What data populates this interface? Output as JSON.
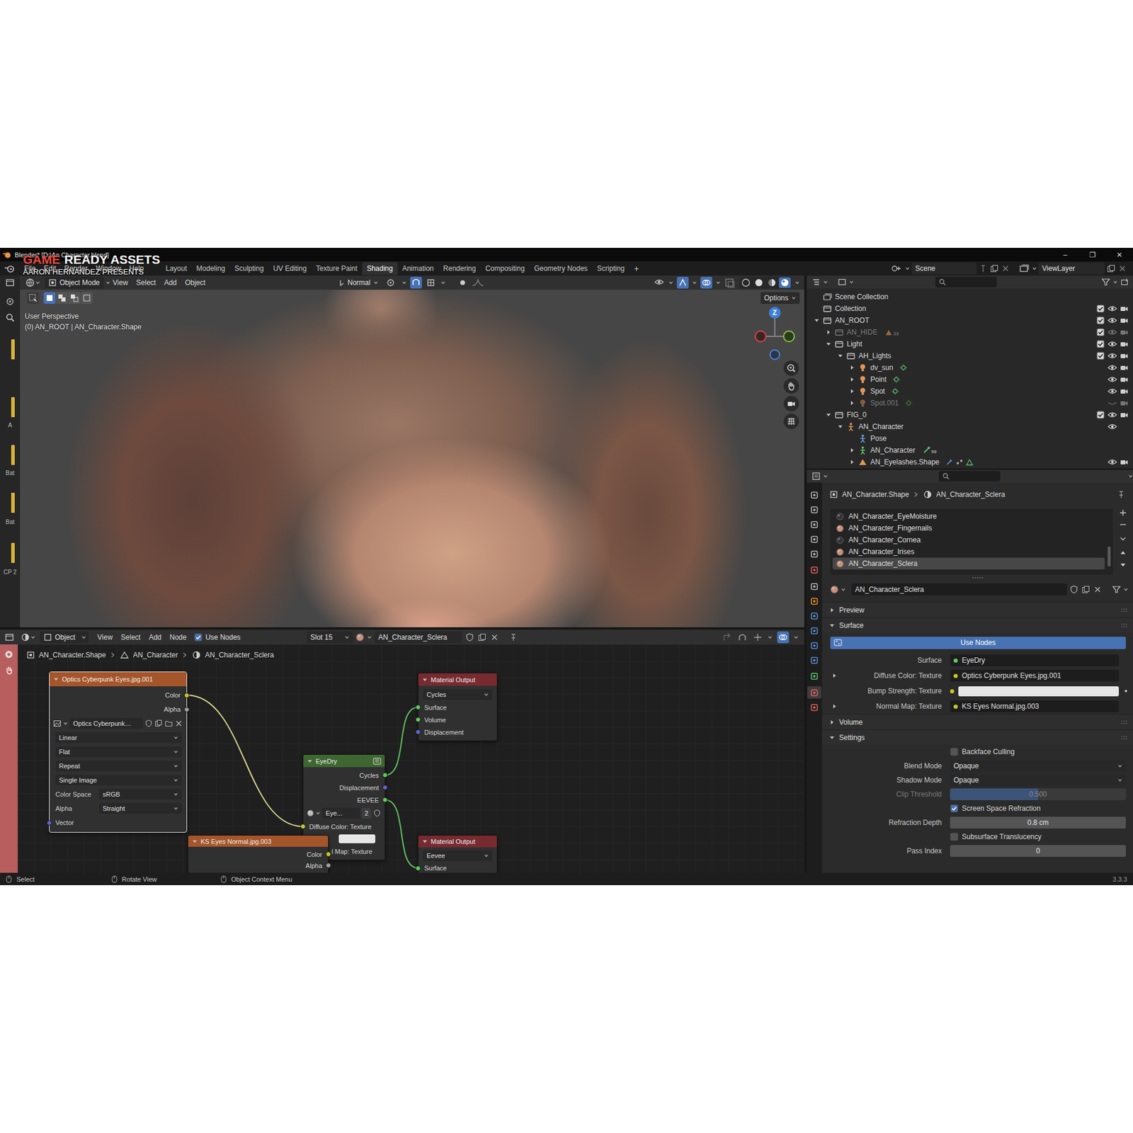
{
  "overlay": {
    "accent": "GAME",
    "title": "READY ASSETS",
    "subtitle": "AARON HERNANDEZ PRESENTS"
  },
  "window": {
    "title": "Blender* [D:\\An Character.blend]",
    "controls": [
      "–",
      "❐",
      "✕"
    ]
  },
  "menu": [
    "File",
    "Edit",
    "Render",
    "Window",
    "Help"
  ],
  "workspaces": [
    {
      "label": "Layout",
      "selected": false
    },
    {
      "label": "Modeling",
      "selected": false
    },
    {
      "label": "Sculpting",
      "selected": false
    },
    {
      "label": "UV Editing",
      "selected": false
    },
    {
      "label": "Texture Paint",
      "selected": false
    },
    {
      "label": "Shading",
      "selected": true
    },
    {
      "label": "Animation",
      "selected": false
    },
    {
      "label": "Rendering",
      "selected": false
    },
    {
      "label": "Compositing",
      "selected": false
    },
    {
      "label": "Geometry Nodes",
      "selected": false
    },
    {
      "label": "Scripting",
      "selected": false
    }
  ],
  "add_workspace": "+",
  "scene": "Scene",
  "view_layer": "ViewLayer",
  "side_strip": [
    "A",
    "Bat",
    "Bat",
    "CP 2"
  ],
  "viewport": {
    "mode": "Object Mode",
    "menus": [
      "View",
      "Select",
      "Add",
      "Object"
    ],
    "orientation": "Normal",
    "options": "Options",
    "perspective": "User Perspective",
    "context": "(0) AN_ROOT | AN_Character.Shape",
    "axis": "Z"
  },
  "outliner": {
    "rows": [
      {
        "label": "Scene Collection",
        "depth": 0,
        "kind": "scene-collection",
        "expandable": false,
        "expanded": false,
        "has_checkbox": false,
        "checked": false,
        "has_eye": false,
        "visible": false,
        "has_camera": false,
        "greyed": false
      },
      {
        "label": "Collection",
        "depth": 1,
        "kind": "collection",
        "expandable": false,
        "expanded": false,
        "has_checkbox": true,
        "checked": true,
        "has_eye": true,
        "visible": true,
        "has_camera": true,
        "greyed": false
      },
      {
        "label": "AN_ROOT",
        "depth": 1,
        "kind": "collection",
        "expandable": true,
        "expanded": true,
        "has_checkbox": true,
        "checked": true,
        "has_eye": true,
        "visible": true,
        "has_camera": true,
        "greyed": false
      },
      {
        "label": "AN_HIDE",
        "depth": 2,
        "kind": "collection",
        "expandable": true,
        "expanded": false,
        "has_checkbox": true,
        "checked": true,
        "has_eye": true,
        "visible": true,
        "has_camera": true,
        "greyed": true,
        "badge": "23"
      },
      {
        "label": "Light",
        "depth": 2,
        "kind": "collection",
        "expandable": true,
        "expanded": true,
        "has_checkbox": true,
        "checked": true,
        "has_eye": true,
        "visible": true,
        "has_camera": true,
        "greyed": false
      },
      {
        "label": "AH_Lights",
        "depth": 3,
        "kind": "collection",
        "expandable": true,
        "expanded": true,
        "has_checkbox": true,
        "checked": true,
        "has_eye": true,
        "visible": true,
        "has_camera": true,
        "greyed": false
      },
      {
        "label": "dv_sun",
        "depth": 4,
        "kind": "light",
        "expandable": true,
        "expanded": false,
        "has_checkbox": false,
        "checked": false,
        "has_eye": true,
        "visible": true,
        "has_camera": true,
        "greyed": false
      },
      {
        "label": "Point",
        "depth": 4,
        "kind": "light",
        "expandable": true,
        "expanded": false,
        "has_checkbox": false,
        "checked": false,
        "has_eye": true,
        "visible": true,
        "has_camera": true,
        "greyed": false
      },
      {
        "label": "Spot",
        "depth": 4,
        "kind": "light",
        "expandable": true,
        "expanded": false,
        "has_checkbox": false,
        "checked": false,
        "has_eye": true,
        "visible": true,
        "has_camera": true,
        "greyed": false
      },
      {
        "label": "Spot.001",
        "depth": 4,
        "kind": "light",
        "expandable": true,
        "expanded": false,
        "has_checkbox": false,
        "checked": false,
        "has_eye": true,
        "visible": false,
        "has_camera": true,
        "greyed": true
      },
      {
        "label": "FIG_0",
        "depth": 2,
        "kind": "collection",
        "expandable": true,
        "expanded": true,
        "has_checkbox": true,
        "checked": true,
        "has_eye": true,
        "visible": true,
        "has_camera": true,
        "greyed": false
      },
      {
        "label": "AN_Character",
        "depth": 3,
        "kind": "armature",
        "expandable": true,
        "expanded": true,
        "has_checkbox": false,
        "checked": false,
        "has_eye": true,
        "visible": true,
        "has_camera": false,
        "greyed": false
      },
      {
        "label": "Pose",
        "depth": 4,
        "kind": "pose",
        "expandable": false,
        "expanded": false,
        "has_checkbox": false,
        "checked": false,
        "has_eye": false,
        "visible": false,
        "has_camera": false,
        "greyed": false
      },
      {
        "label": "AN_Character",
        "depth": 4,
        "kind": "armature-data",
        "expandable": true,
        "expanded": false,
        "has_checkbox": false,
        "checked": false,
        "has_eye": false,
        "visible": false,
        "has_camera": false,
        "greyed": false,
        "badge": "99"
      },
      {
        "label": "AN_Eyelashes.Shape",
        "depth": 4,
        "kind": "mesh",
        "expandable": true,
        "expanded": false,
        "has_checkbox": false,
        "checked": false,
        "has_eye": true,
        "visible": true,
        "has_camera": true,
        "greyed": false
      }
    ]
  },
  "properties": {
    "tabs": [
      {
        "selected": false,
        "color": "#b8b8b8"
      },
      {
        "selected": false,
        "color": "#b8b8b8"
      },
      {
        "selected": false,
        "color": "#b8b8b8"
      },
      {
        "selected": false,
        "color": "#b8b8b8"
      },
      {
        "selected": false,
        "color": "#b8b8b8"
      },
      {
        "selected": false,
        "color": "#e06060"
      },
      {
        "selected": false,
        "color": "#b8b8b8"
      },
      {
        "selected": false,
        "color": "#e8902a"
      },
      {
        "selected": false,
        "color": "#5a8fd8"
      },
      {
        "selected": false,
        "color": "#5a8fd8"
      },
      {
        "selected": false,
        "color": "#5a8fd8"
      },
      {
        "selected": false,
        "color": "#5a8fd8"
      },
      {
        "selected": false,
        "color": "#5ac86a"
      },
      {
        "selected": true,
        "color": "#e06060"
      },
      {
        "selected": false,
        "color": "#e06060"
      }
    ],
    "breadcrumb": [
      "AN_Character.Shape",
      "AN_Character_Sclera"
    ],
    "slots": [
      {
        "label": "AN_Character_EyeMoisture",
        "selected": false,
        "color": "#333333"
      },
      {
        "label": "AN_Character_Fingernails",
        "selected": false,
        "color": "#c9907a"
      },
      {
        "label": "AN_Character_Cornea",
        "selected": false,
        "color": "#333333"
      },
      {
        "label": "AN_Character_Irises",
        "selected": false,
        "color": "#c9907a"
      },
      {
        "label": "AN_Character_Sclera",
        "selected": true,
        "color": "#c9907a"
      }
    ],
    "material": "AN_Character_Sclera",
    "rows": [
      {
        "kind": "section",
        "label": "Preview",
        "expanded": false
      },
      {
        "kind": "section",
        "label": "Surface",
        "expanded": true
      },
      {
        "kind": "button",
        "label": "Use Nodes",
        "on": true
      },
      {
        "kind": "link",
        "label": "Surface",
        "value": "EyeDry",
        "socket": "#63c763",
        "expandable": false
      },
      {
        "kind": "link",
        "label": "Diffuse Color: Texture",
        "value": "Optics Cyberpunk Eyes.jpg.001",
        "socket": "#c7c729",
        "expandable": true
      },
      {
        "kind": "color",
        "label": "Bump Strength: Texture",
        "socket": "#c7c729",
        "swatch": "#e6e6e6"
      },
      {
        "kind": "link",
        "label": "Normal Map: Texture",
        "value": "KS Eyes Normal.jpg.003",
        "socket": "#c7c729",
        "expandable": true
      },
      {
        "kind": "section",
        "label": "Volume",
        "expanded": false
      },
      {
        "kind": "section",
        "label": "Settings",
        "expanded": true
      },
      {
        "kind": "checkbox",
        "label": "Backface Culling",
        "checked": false
      },
      {
        "kind": "dropdown",
        "label": "Blend Mode",
        "value": "Opaque"
      },
      {
        "kind": "dropdown",
        "label": "Shadow Mode",
        "value": "Opaque"
      },
      {
        "kind": "slider",
        "label": "Clip Threshold",
        "value": "0.500",
        "level": 0.5,
        "disabled": true
      },
      {
        "kind": "checkbox",
        "label": "Screen Space Refraction",
        "checked": true
      },
      {
        "kind": "number",
        "label": "Refraction Depth",
        "value": "0.8 cm"
      },
      {
        "kind": "checkbox",
        "label": "Subsurface Translucency",
        "checked": false
      },
      {
        "kind": "number",
        "label": "Pass Index",
        "value": "0"
      }
    ]
  },
  "node_editor": {
    "mode": "Object",
    "menus": [
      "View",
      "Select",
      "Add",
      "Node"
    ],
    "use_nodes": {
      "label": "Use Nodes",
      "checked": true
    },
    "slot": "Slot 15",
    "material": "AN_Character_Sclera",
    "breadcrumb": [
      "AN_Character.Shape",
      "AN_Character",
      "AN_Character_Sclera"
    ],
    "nodes": [
      {
        "kind": "texture",
        "title": "Optics Cyberpunk Eyes.jpg.001",
        "selected": true,
        "outputs": [
          {
            "label": "Color",
            "color": "#c7c729"
          },
          {
            "label": "Alpha",
            "color": "#a1a1a1"
          }
        ],
        "image": "Optics Cyberpunk…",
        "options": [
          {
            "value": "Linear"
          },
          {
            "value": "Flat"
          },
          {
            "value": "Repeat"
          },
          {
            "value": "Single Image"
          },
          {
            "label": "Color Space",
            "value": "sRGB"
          },
          {
            "label": "Alpha",
            "value": "Straight"
          }
        ],
        "inputs": [
          {
            "label": "Vector",
            "color": "#6363c7"
          }
        ]
      },
      {
        "kind": "output",
        "title": "Material Output",
        "selected": false,
        "outputs": [],
        "target": "Cycles",
        "inputs": [
          {
            "label": "Surface",
            "color": "#63c763"
          },
          {
            "label": "Volume",
            "color": "#63c763"
          },
          {
            "label": "Displacement",
            "color": "#6363c7"
          }
        ]
      },
      {
        "kind": "group",
        "title": "EyeDry",
        "selected": false,
        "outputs": [
          {
            "label": "Cycles",
            "color": "#63c763"
          },
          {
            "label": "Displacement",
            "color": "#6363c7"
          },
          {
            "label": "EEVEE",
            "color": "#63c763"
          }
        ],
        "group": "Eye...",
        "users": "2",
        "inputs": [
          {
            "label": "Diffuse Color: Texture",
            "color": "#c7c729"
          },
          {
            "swatch": "#e6e6e6",
            "color": "#c7c729"
          },
          {
            "label": "l Map: Texture",
            "color": "#c7c729"
          }
        ]
      },
      {
        "kind": "texture",
        "title": "KS Eyes Normal.jpg.003",
        "selected": false,
        "outputs": [
          {
            "label": "Color",
            "color": "#c7c729"
          },
          {
            "label": "Alpha",
            "color": "#a1a1a1"
          }
        ],
        "inputs": []
      },
      {
        "kind": "output",
        "title": "Material Output",
        "selected": false,
        "outputs": [],
        "target": "Eevee",
        "inputs": [
          {
            "label": "Surface",
            "color": "#63c763"
          }
        ]
      }
    ],
    "links": [
      {
        "from": [
          0,
          0
        ],
        "to": [
          2,
          0
        ],
        "color": "#dcdc96"
      },
      {
        "from": [
          2,
          0
        ],
        "to": [
          1,
          0
        ],
        "color": "#63c763"
      },
      {
        "from": [
          2,
          2
        ],
        "to": [
          4,
          0
        ],
        "color": "#63c763"
      },
      {
        "from": [
          3,
          0
        ],
        "to": [
          2,
          2
        ],
        "color": "#c7c729"
      }
    ]
  },
  "status_bar": {
    "hints": [
      "Select",
      "Rotate View",
      "Object Context Menu"
    ],
    "version": "3.3.3"
  }
}
